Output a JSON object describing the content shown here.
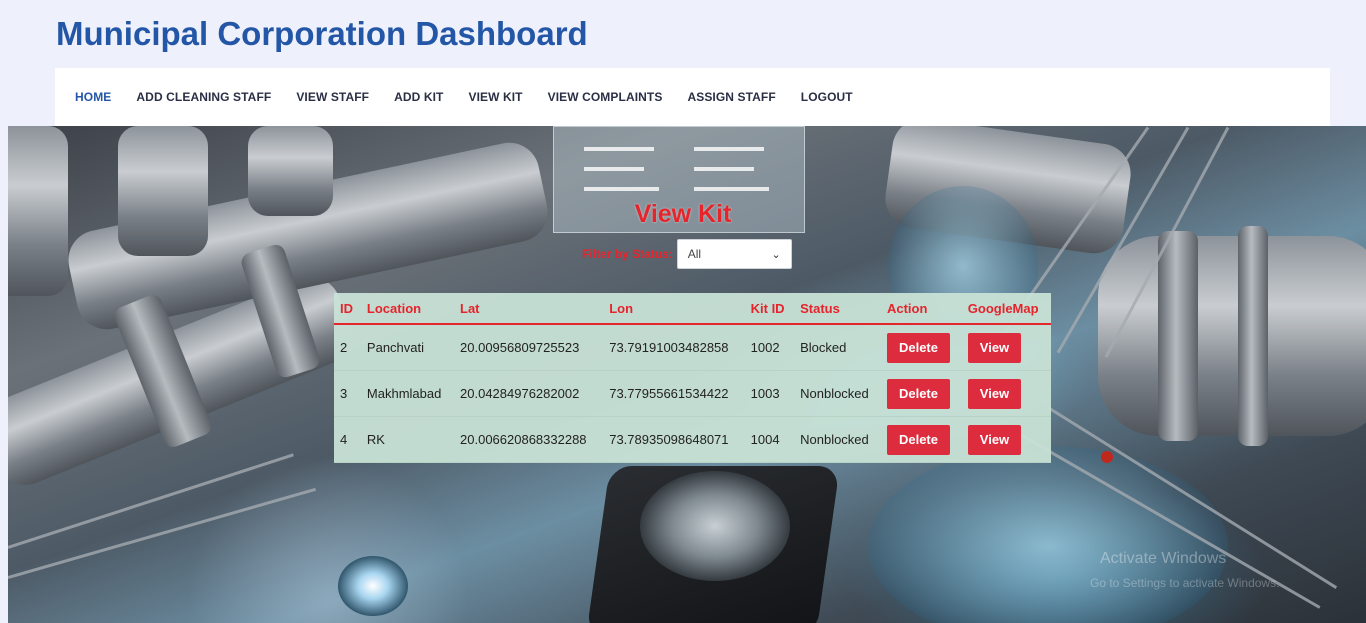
{
  "header": {
    "title": "Municipal Corporation Dashboard"
  },
  "nav": {
    "items": [
      {
        "label": "HOME",
        "active": true
      },
      {
        "label": "ADD CLEANING STAFF"
      },
      {
        "label": "VIEW STAFF"
      },
      {
        "label": "ADD KIT"
      },
      {
        "label": "VIEW KIT"
      },
      {
        "label": "VIEW COMPLAINTS"
      },
      {
        "label": "ASSIGN STAFF"
      },
      {
        "label": "LOGOUT"
      }
    ]
  },
  "content": {
    "heading": "View Kit",
    "filter": {
      "label": "Filter by Status:",
      "selected": "All"
    },
    "table": {
      "columns": [
        "ID",
        "Location",
        "Lat",
        "Lon",
        "Kit ID",
        "Status",
        "Action",
        "GoogleMap"
      ],
      "rows": [
        {
          "id": "2",
          "location": "Panchvati",
          "lat": "20.00956809725523",
          "lon": "73.79191003482858",
          "kit_id": "1002",
          "status": "Blocked",
          "action": "Delete",
          "map": "View"
        },
        {
          "id": "3",
          "location": "Makhmlabad",
          "lat": "20.04284976282002",
          "lon": "73.77955661534422",
          "kit_id": "1003",
          "status": "Nonblocked",
          "action": "Delete",
          "map": "View"
        },
        {
          "id": "4",
          "location": "RK",
          "lat": "20.006620868332288",
          "lon": "73.78935098648071",
          "kit_id": "1004",
          "status": "Nonblocked",
          "action": "Delete",
          "map": "View"
        }
      ]
    }
  },
  "watermark": {
    "line1": "Activate Windows",
    "line2": "Go to Settings to activate Windows."
  },
  "colors": {
    "title": "#2356a6",
    "accent_red": "#e6242c",
    "button_red": "#dc2c3e",
    "table_bg": "#c8e2d6"
  }
}
